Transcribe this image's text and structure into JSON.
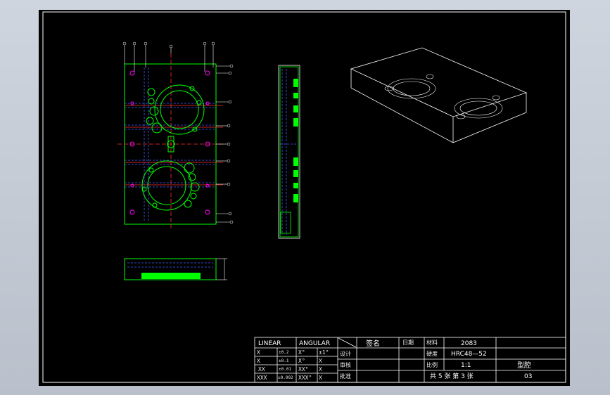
{
  "colors": {
    "background": "#000000",
    "frame": "#ffffff",
    "outline": "#00ff00",
    "centerline": "#ff3030",
    "hidden": "#4060ff",
    "hole": "#ff00ff",
    "leader": "#ffffff",
    "iso": "#ffffff"
  },
  "title_block": {
    "linear_label": "LINEAR",
    "angular_label": "ANGULAR",
    "sign_label": "签名",
    "date_label": "日期",
    "material_label": "材料",
    "material_value": "2083",
    "hardness_label": "硬度",
    "hardness_value": "HRC48—52",
    "scale_label": "比例",
    "scale_value": "1:1",
    "drawing_name": "型腔",
    "drawing_number": "03",
    "sheets_text": "共 5 张 第 3 张",
    "design_label": "设计",
    "review_label": "审核",
    "approve_label": "批准",
    "tol_rows": [
      {
        "lin": "X",
        "lin_tol": "±0.2",
        "ang": "X°",
        "ang_tol": "±1°"
      },
      {
        "lin": "X",
        "lin_tol": "±0.1",
        "ang": "X°",
        "ang_tol": "X"
      },
      {
        "lin": "XX",
        "lin_tol": "±0.01",
        "ang": "XX°",
        "ang_tol": "X"
      },
      {
        "lin": "XXX",
        "lin_tol": "±0.002",
        "ang": "XXX°",
        "ang_tol": "X"
      }
    ]
  }
}
